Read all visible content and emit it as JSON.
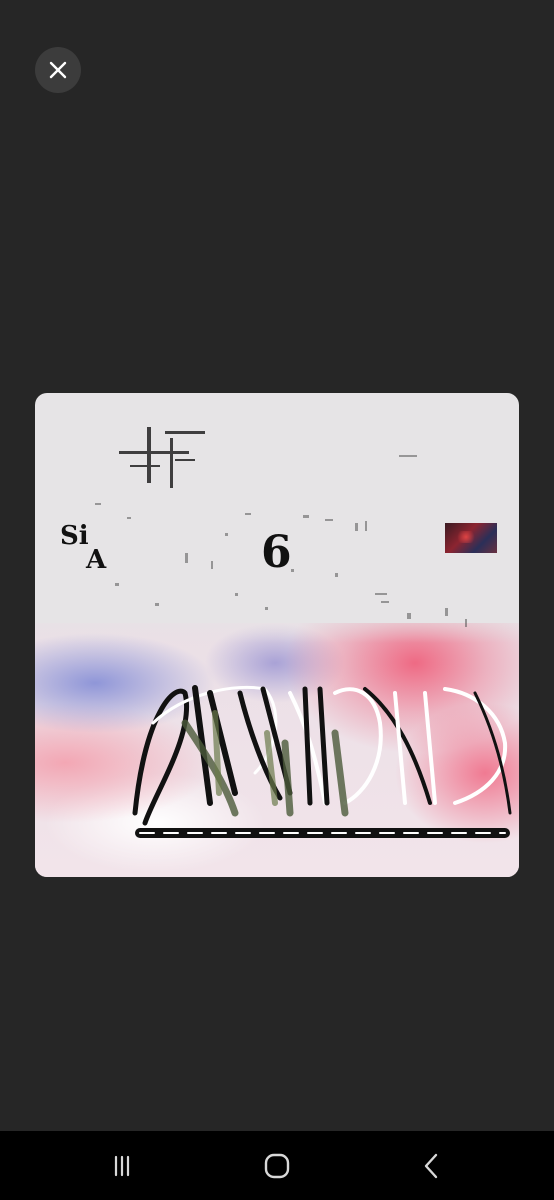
{
  "viewer": {
    "close_icon": "close-icon",
    "background_color": "#262626"
  },
  "artwork": {
    "corner_text_top": "Si",
    "corner_text_bottom": "A",
    "number_text": "6",
    "scribble_text": "CRASHHGANG",
    "accent_colors": [
      "#ee6a84",
      "#8f96d8",
      "#e6e4e6"
    ]
  },
  "nav_bar": {
    "recents_icon": "recents-icon",
    "home_icon": "home-icon",
    "back_icon": "back-icon"
  }
}
